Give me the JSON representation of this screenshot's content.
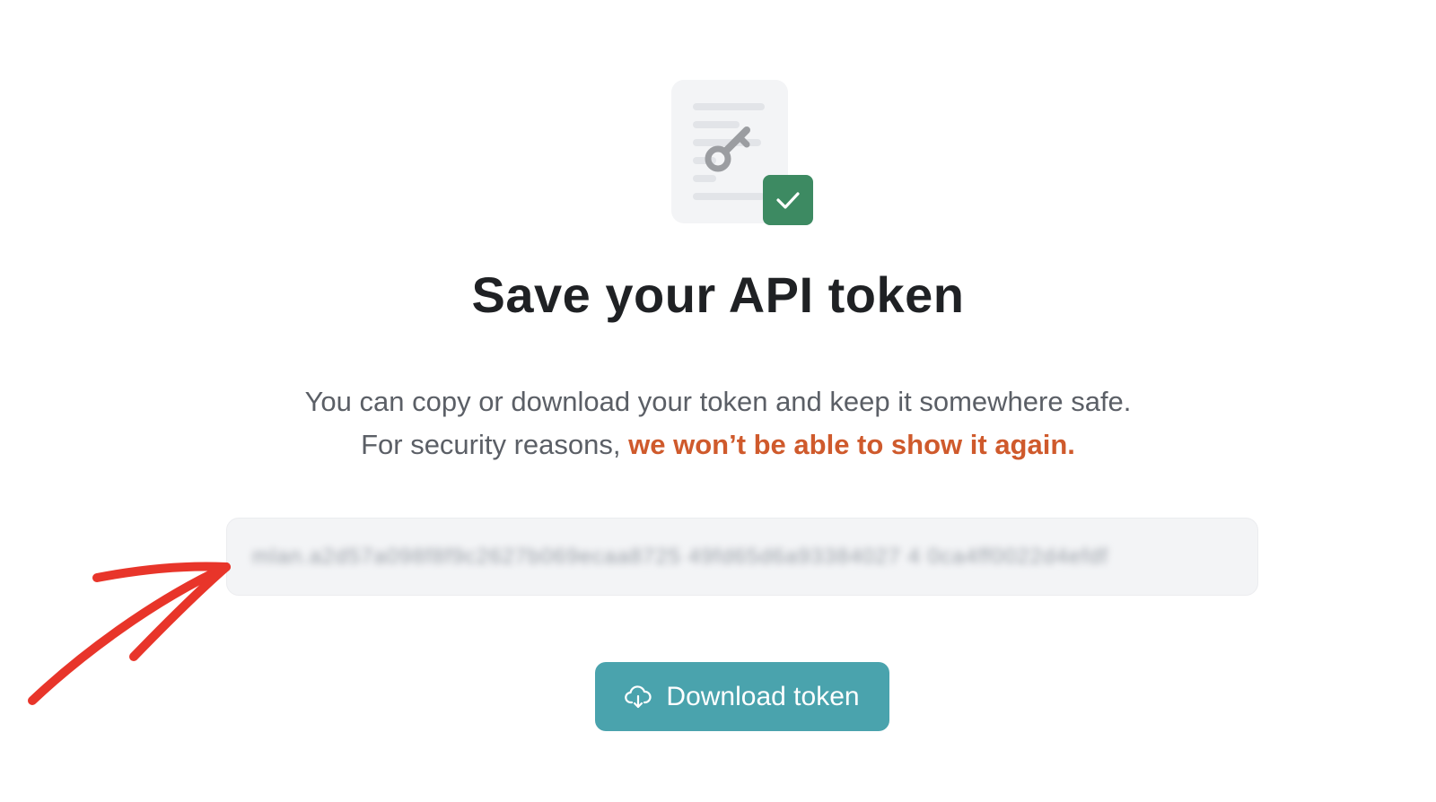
{
  "icons": {
    "document": "document-icon",
    "key": "key-icon",
    "check": "check-icon",
    "download": "cloud-download-icon",
    "annotation": "red-arrow-annotation"
  },
  "colors": {
    "accent_button": "#4aa3ad",
    "success_badge": "#3d8a62",
    "warning_text": "#cf5a2c",
    "annotation_arrow": "#e8352a"
  },
  "heading": {
    "title": "Save your API token"
  },
  "description": {
    "line1": "You can copy or download your token and keep it somewhere safe.",
    "line2_prefix": "For security reasons, ",
    "line2_warning": "we won’t be able to show it again."
  },
  "token": {
    "value": "mlan.a2d57a098f8f9c2627b069ecaa8725 49fd65d6a93384027 4 0ca4ff0022d4efdf"
  },
  "actions": {
    "download_label": "Download token"
  }
}
